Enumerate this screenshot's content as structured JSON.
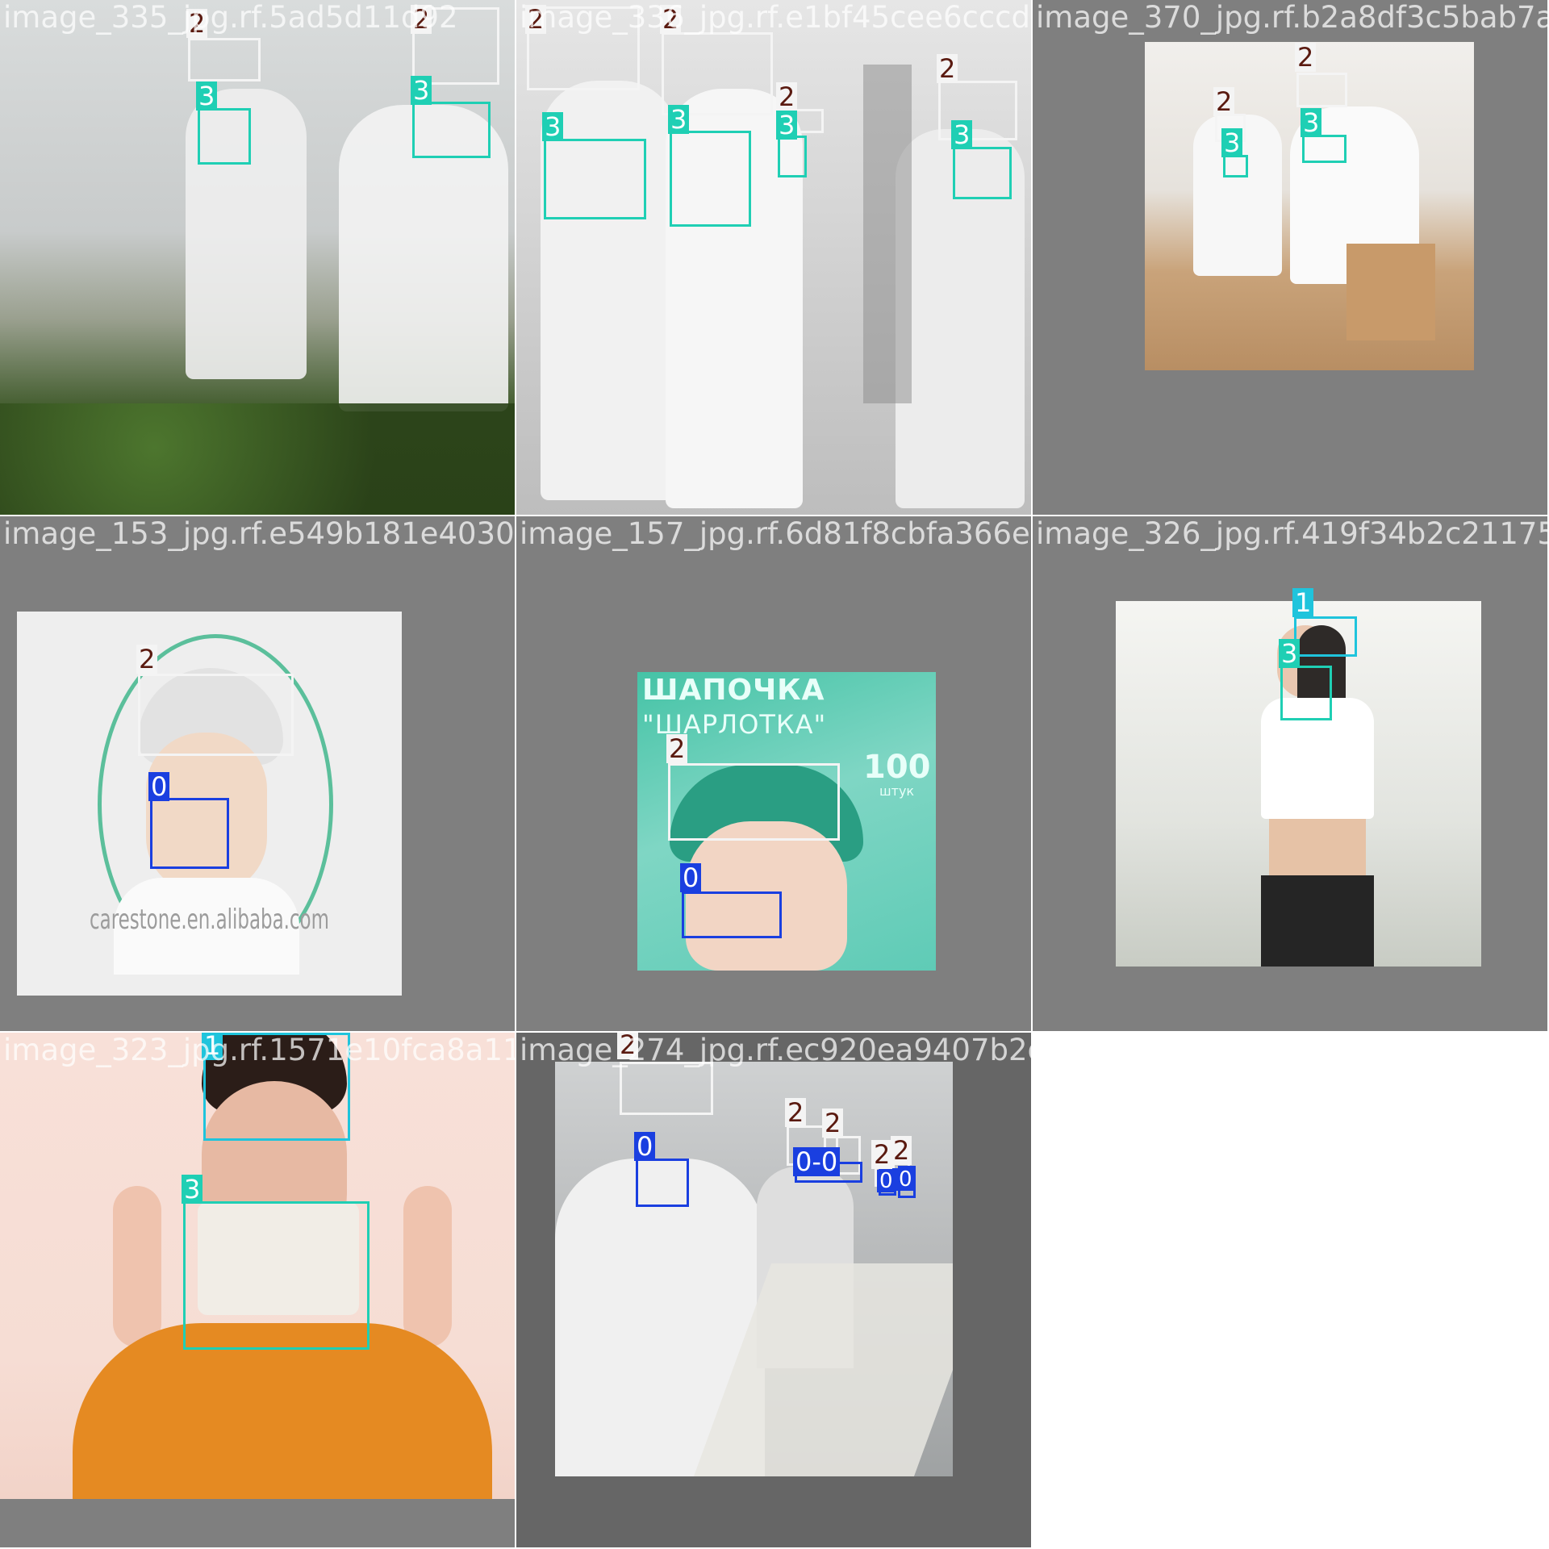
{
  "colors": {
    "class_0": "#1a3fe0",
    "class_1": "#1fc4dc",
    "class_2": "#f4f4f4",
    "class_3": "#1fcfb4",
    "padding_gray": "#7f7f7f"
  },
  "tiles": [
    {
      "filename": "image_335_jpg.rf.5ad5d11d92",
      "detections": [
        {
          "label": "2"
        },
        {
          "label": "2"
        },
        {
          "label": "3"
        },
        {
          "label": "3"
        }
      ]
    },
    {
      "filename": "image_336_jpg.rf.e1bf45cee6cccde6e",
      "detections": [
        {
          "label": "2"
        },
        {
          "label": "2"
        },
        {
          "label": "2"
        },
        {
          "label": "2"
        },
        {
          "label": "3"
        },
        {
          "label": "3"
        },
        {
          "label": "3"
        },
        {
          "label": "3"
        }
      ]
    },
    {
      "filename": "image_370_jpg.rf.b2a8df3c5bab7ab98",
      "detections": [
        {
          "label": "2"
        },
        {
          "label": "2"
        },
        {
          "label": "3"
        },
        {
          "label": "3"
        }
      ]
    },
    {
      "filename": "image_153_jpg.rf.e549b181e40305ef5e202b",
      "detections": [
        {
          "label": "2"
        },
        {
          "label": "0"
        }
      ],
      "watermark": "carestone.en.alibaba.com"
    },
    {
      "filename": "image_157_jpg.rf.6d81f8cbfa366ea2f2c285",
      "detections": [
        {
          "label": "2"
        },
        {
          "label": "0"
        }
      ],
      "poster_title": "ШАПОЧКА",
      "poster_subtitle": "\"ШАРЛОТКА\"",
      "poster_count": "100",
      "poster_unit": "штук"
    },
    {
      "filename": "image_326_jpg.rf.419f34b2c21175888",
      "detections": [
        {
          "label": "1"
        },
        {
          "label": "3"
        }
      ]
    },
    {
      "filename": "image_323_jpg.rf.1571e10fca8a1192b9efe2",
      "detections": [
        {
          "label": "1"
        },
        {
          "label": "3"
        }
      ]
    },
    {
      "filename": "image_274_jpg.rf.ec920ea9407b2d703f31857",
      "detections": [
        {
          "label": "2"
        },
        {
          "label": "2"
        },
        {
          "label": "2"
        },
        {
          "label": "2"
        },
        {
          "label": "2"
        },
        {
          "label": "0"
        },
        {
          "label": "0-0"
        },
        {
          "label": "0"
        },
        {
          "label": "0"
        }
      ]
    }
  ]
}
